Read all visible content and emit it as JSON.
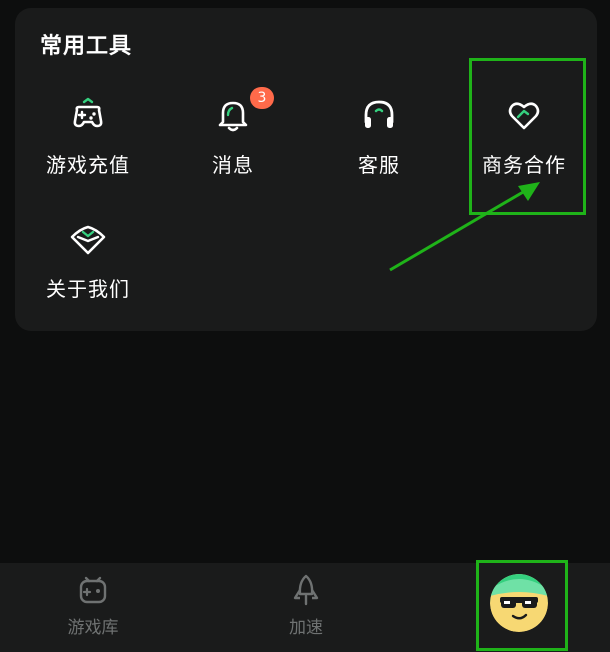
{
  "tools_section": {
    "title": "常用工具",
    "items": [
      {
        "label": "游戏充值",
        "icon": "gamepad-icon"
      },
      {
        "label": "消息",
        "icon": "bell-icon",
        "badge": "3"
      },
      {
        "label": "客服",
        "icon": "headset-icon"
      },
      {
        "label": "商务合作",
        "icon": "heart-handshake-icon"
      },
      {
        "label": "关于我们",
        "icon": "badge-chevron-icon"
      }
    ]
  },
  "bottom_nav": {
    "items": [
      {
        "label": "游戏库",
        "icon": "gamepad-icon"
      },
      {
        "label": "加速",
        "icon": "rocket-icon"
      },
      {
        "label": "",
        "icon": "avatar-face"
      }
    ]
  },
  "colors": {
    "background": "#0d0e0e",
    "card": "#1a1b1b",
    "accent_green": "#35d07f",
    "annotation_green": "#1fb319",
    "badge": "#ff6a4a",
    "nav_inactive": "#6f7272"
  }
}
